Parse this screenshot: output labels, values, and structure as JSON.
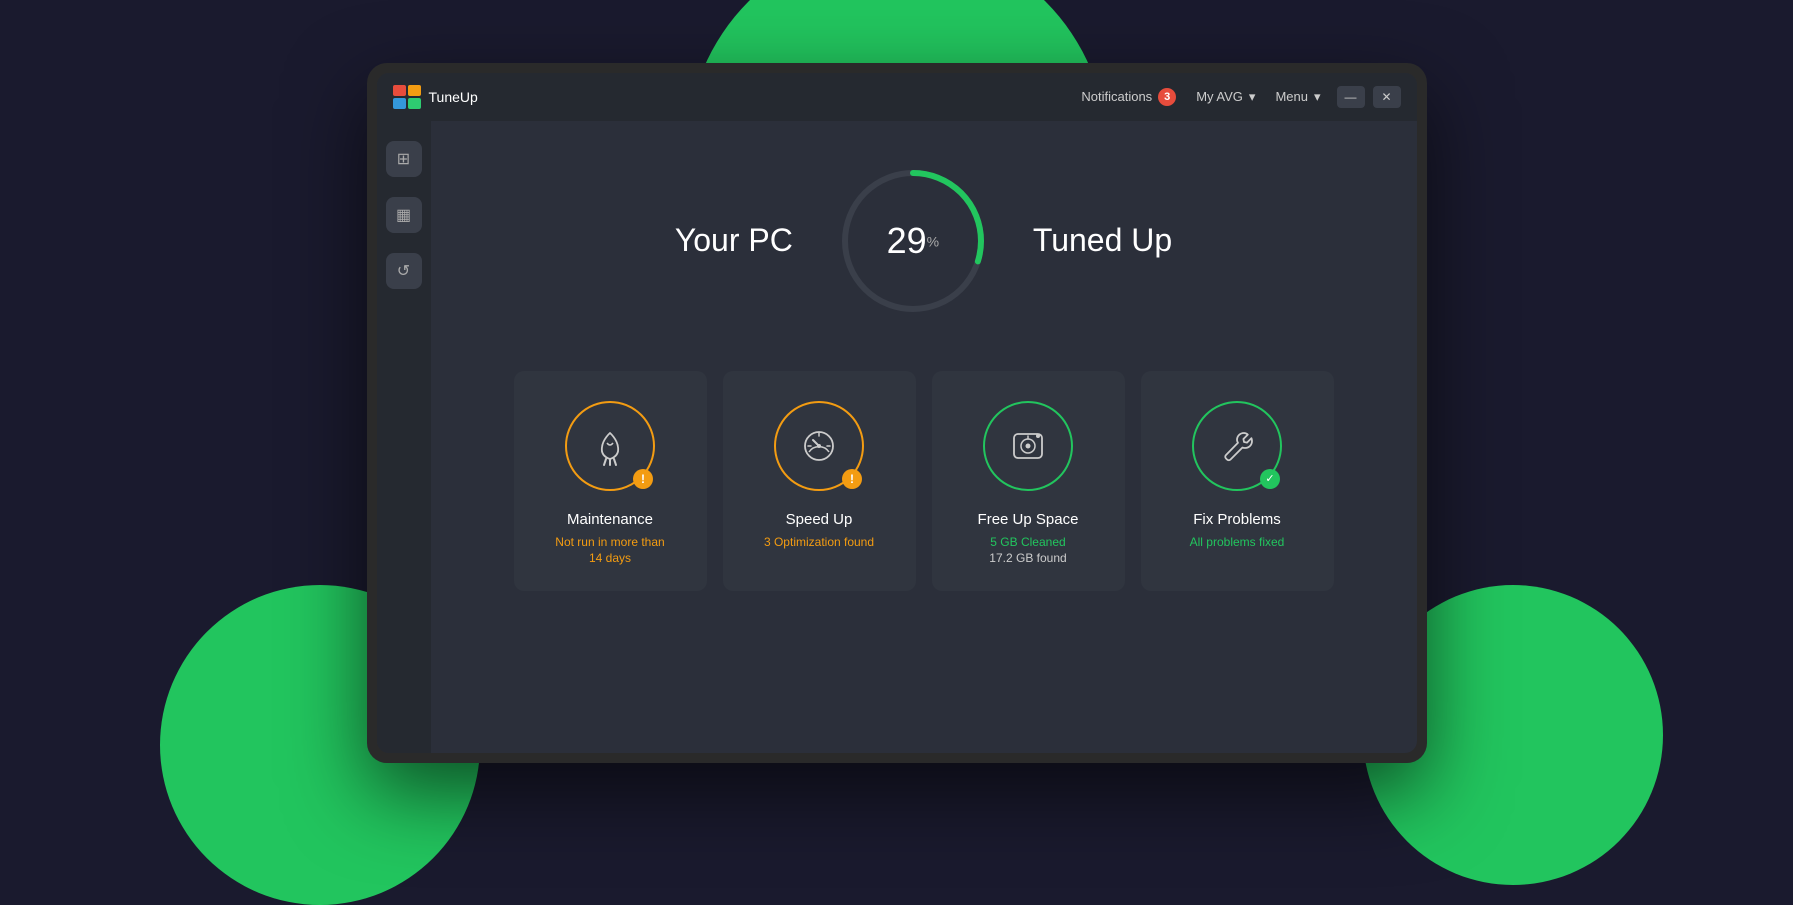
{
  "app": {
    "logo_alt": "AVG TuneUp",
    "title": "TuneUp"
  },
  "titlebar": {
    "notifications_label": "Notifications",
    "notifications_count": "3",
    "my_avg_label": "My AVG",
    "menu_label": "Menu",
    "minimize_label": "—",
    "close_label": "✕"
  },
  "gauge": {
    "left_text": "Your PC",
    "right_text": "Tuned Up",
    "percent_value": "29",
    "percent_symbol": "%",
    "progress": 29
  },
  "cards": [
    {
      "id": "maintenance",
      "title": "Maintenance",
      "status_line1": "Not run in more than",
      "status_line2": "14 days",
      "status_color": "orange",
      "badge_type": "alert",
      "icon": "🧹",
      "border_color": "orange"
    },
    {
      "id": "speed-up",
      "title": "Speed Up",
      "status_line1": "3 Optimization found",
      "status_line2": "",
      "status_color": "orange",
      "badge_type": "alert",
      "icon": "⚡",
      "border_color": "orange"
    },
    {
      "id": "free-up-space",
      "title": "Free Up Space",
      "status_line1": "5 GB Cleaned",
      "status_line2": "17.2 GB found",
      "status_color": "green",
      "badge_type": "none",
      "icon": "💿",
      "border_color": "green"
    },
    {
      "id": "fix-problems",
      "title": "Fix Problems",
      "status_line1": "All problems fixed",
      "status_line2": "",
      "status_color": "green",
      "badge_type": "check",
      "icon": "🔧",
      "border_color": "green"
    }
  ],
  "sidebar": {
    "icons": [
      "grid",
      "bar-chart",
      "refresh"
    ]
  }
}
